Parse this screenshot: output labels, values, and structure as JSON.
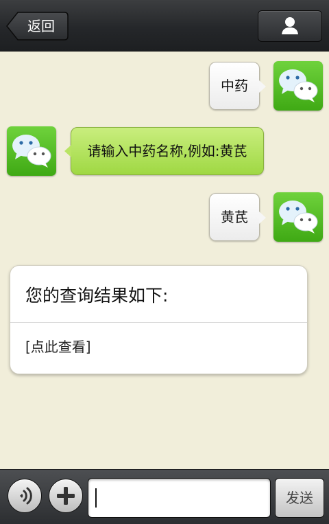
{
  "header": {
    "back_label": "返回",
    "profile_icon": "person-icon"
  },
  "messages": [
    {
      "side": "right",
      "type": "text",
      "text": "中药",
      "avatar_icon": "wechat-icon"
    },
    {
      "side": "left",
      "type": "text",
      "text": "请输入中药名称,例如:黄芪",
      "avatar_icon": "wechat-icon"
    },
    {
      "side": "right",
      "type": "text",
      "text": "黄芪",
      "avatar_icon": "wechat-icon"
    },
    {
      "side": "left",
      "type": "card",
      "title": "您的查询结果如下:",
      "link": "[点此查看]"
    }
  ],
  "input_bar": {
    "voice_icon": "voice-icon",
    "plus_icon": "plus-icon",
    "input_value": "",
    "send_label": "发送"
  },
  "colors": {
    "background": "#f1eeda",
    "bubble_green": "#b5e25f",
    "avatar_green": "#52bd20",
    "topbar": "#2a2c2f"
  }
}
